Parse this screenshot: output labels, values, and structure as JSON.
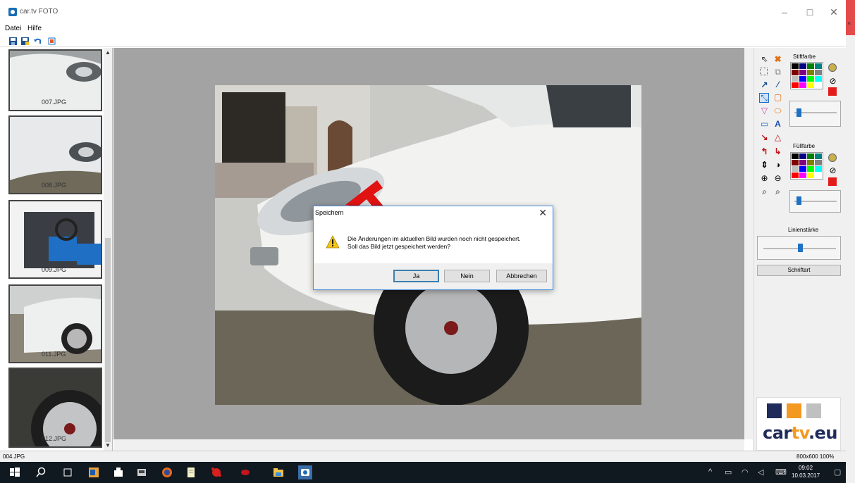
{
  "window": {
    "title": "car.tv FOTO"
  },
  "menu": {
    "items": [
      "Datei",
      "Hilfe"
    ]
  },
  "toolbar": {
    "icons": [
      "save-icon",
      "save-as-icon",
      "undo-icon",
      "print-icon"
    ]
  },
  "thumbnails": [
    {
      "label": "007.JPG"
    },
    {
      "label": "008.JPG"
    },
    {
      "label": "009.JPG"
    },
    {
      "label": "011.JPG"
    },
    {
      "label": "012.JPG"
    }
  ],
  "dialog": {
    "title": "Speichern",
    "message_line1": "Die Änderungen im aktuellen Bild wurden noch nicht gespeichert.",
    "message_line2": "Soll das Bild jetzt gespeichert werden?",
    "btn_yes": "Ja",
    "btn_no": "Nein",
    "btn_cancel": "Abbrechen"
  },
  "tools_panel": {
    "stroke_label": "Stiftfarbe",
    "fill_label": "Füllfarbe",
    "line_width_label": "Linienstärke",
    "font_button": "Schriftart",
    "stroke_level": 0.1,
    "fill_level": 0.1,
    "line_width_level": 0.5
  },
  "palette_colors": [
    "#000000",
    "#000080",
    "#008000",
    "#008080",
    "#800000",
    "#800080",
    "#808000",
    "#808080",
    "#c0c0c0",
    "#0000ff",
    "#00ff00",
    "#00ffff",
    "#ff0000",
    "#ff00ff",
    "#ffff00",
    "#ffffff"
  ],
  "logo": {
    "text_main": "car",
    "text_accent": "tv",
    "text_end": ".eu",
    "colors": [
      "#1f2b5a",
      "#f39820",
      "#c0c0c0"
    ]
  },
  "status": {
    "filename": "004.JPG",
    "info": "800x600  100%"
  },
  "taskbar": {
    "time": "09:02",
    "date": "10.03.2017"
  }
}
